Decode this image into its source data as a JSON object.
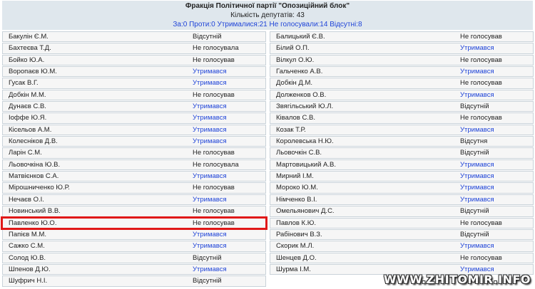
{
  "header": {
    "title": "Фракція Політичної партії \"Опозиційний блок\"",
    "count": "Кількість депутатів: 43",
    "stats": "За:0 Проти:0 Утрималися:21 Не голосували:14 Відсутні:8"
  },
  "left_rows": [
    {
      "name": "Бакулін Є.М.",
      "vote": "Відсутній",
      "abstain": false
    },
    {
      "name": "Бахтеєва Т.Д.",
      "vote": "Не голосувала",
      "abstain": false
    },
    {
      "name": "Бойко Ю.А.",
      "vote": "Не голосував",
      "abstain": false
    },
    {
      "name": "Воропаєв Ю.М.",
      "vote": "Утримався",
      "abstain": true
    },
    {
      "name": "Гусак В.Г.",
      "vote": "Утримався",
      "abstain": true
    },
    {
      "name": "Добкін М.М.",
      "vote": "Не голосував",
      "abstain": false
    },
    {
      "name": "Дунаєв С.В.",
      "vote": "Утримався",
      "abstain": true
    },
    {
      "name": "Іоффе Ю.Я.",
      "vote": "Утримався",
      "abstain": true
    },
    {
      "name": "Кісельов А.М.",
      "vote": "Утримався",
      "abstain": true
    },
    {
      "name": "Колесніков Д.В.",
      "vote": "Утримався",
      "abstain": true
    },
    {
      "name": "Ларін С.М.",
      "vote": "Не голосував",
      "abstain": false
    },
    {
      "name": "Льовочкіна Ю.В.",
      "vote": "Не голосувала",
      "abstain": false
    },
    {
      "name": "Матвієнков С.А.",
      "vote": "Утримався",
      "abstain": true
    },
    {
      "name": "Мірошниченко Ю.Р.",
      "vote": "Не голосував",
      "abstain": false
    },
    {
      "name": "Нечаєв О.І.",
      "vote": "Утримався",
      "abstain": true
    },
    {
      "name": "Новинський В.В.",
      "vote": "Не голосував",
      "abstain": false
    },
    {
      "name": "Павленко Ю.О.",
      "vote": "Не голосував",
      "abstain": false,
      "highlight": true
    },
    {
      "name": "Папієв М.М.",
      "vote": "Утримався",
      "abstain": true
    },
    {
      "name": "Сажко С.М.",
      "vote": "Утримався",
      "abstain": true
    },
    {
      "name": "Солод Ю.В.",
      "vote": "Відсутній",
      "abstain": false
    },
    {
      "name": "Шпенов Д.Ю.",
      "vote": "Утримався",
      "abstain": true
    },
    {
      "name": "Шуфрич Н.І.",
      "vote": "Відсутній",
      "abstain": false
    }
  ],
  "right_rows": [
    {
      "name": "Балицький Є.В.",
      "vote": "Не голосував",
      "abstain": false
    },
    {
      "name": "Білий О.П.",
      "vote": "Утримався",
      "abstain": true
    },
    {
      "name": "Вілкул О.Ю.",
      "vote": "Не голосував",
      "abstain": false
    },
    {
      "name": "Гальченко А.В.",
      "vote": "Утримався",
      "abstain": true
    },
    {
      "name": "Добкін Д.М.",
      "vote": "Не голосував",
      "abstain": false
    },
    {
      "name": "Долженков О.В.",
      "vote": "Утримався",
      "abstain": true
    },
    {
      "name": "Звягільський Ю.Л.",
      "vote": "Відсутній",
      "abstain": false
    },
    {
      "name": "Ківалов С.В.",
      "vote": "Не голосував",
      "abstain": false
    },
    {
      "name": "Козак Т.Р.",
      "vote": "Утримався",
      "abstain": true
    },
    {
      "name": "Королевська Н.Ю.",
      "vote": "Відсутня",
      "abstain": false
    },
    {
      "name": "Льовочкін С.В.",
      "vote": "Відсутній",
      "abstain": false
    },
    {
      "name": "Мартовицький А.В.",
      "vote": "Утримався",
      "abstain": true
    },
    {
      "name": "Мирний І.М.",
      "vote": "Утримався",
      "abstain": true
    },
    {
      "name": "Мороко Ю.М.",
      "vote": "Утримався",
      "abstain": true
    },
    {
      "name": "Німченко В.І.",
      "vote": "Утримався",
      "abstain": true
    },
    {
      "name": "Омельянович Д.С.",
      "vote": "Відсутній",
      "abstain": false
    },
    {
      "name": "Павлов К.Ю.",
      "vote": "Не голосував",
      "abstain": false
    },
    {
      "name": "Рабінович В.З.",
      "vote": "Відсутній",
      "abstain": false
    },
    {
      "name": "Скорик М.Л.",
      "vote": "Утримався",
      "abstain": true
    },
    {
      "name": "Шенцев Д.О.",
      "vote": "Не голосував",
      "abstain": false
    },
    {
      "name": "Шурма І.М.",
      "vote": "Утримався",
      "abstain": true
    }
  ],
  "watermark": "WWW.ZHITOMIR.INFO"
}
